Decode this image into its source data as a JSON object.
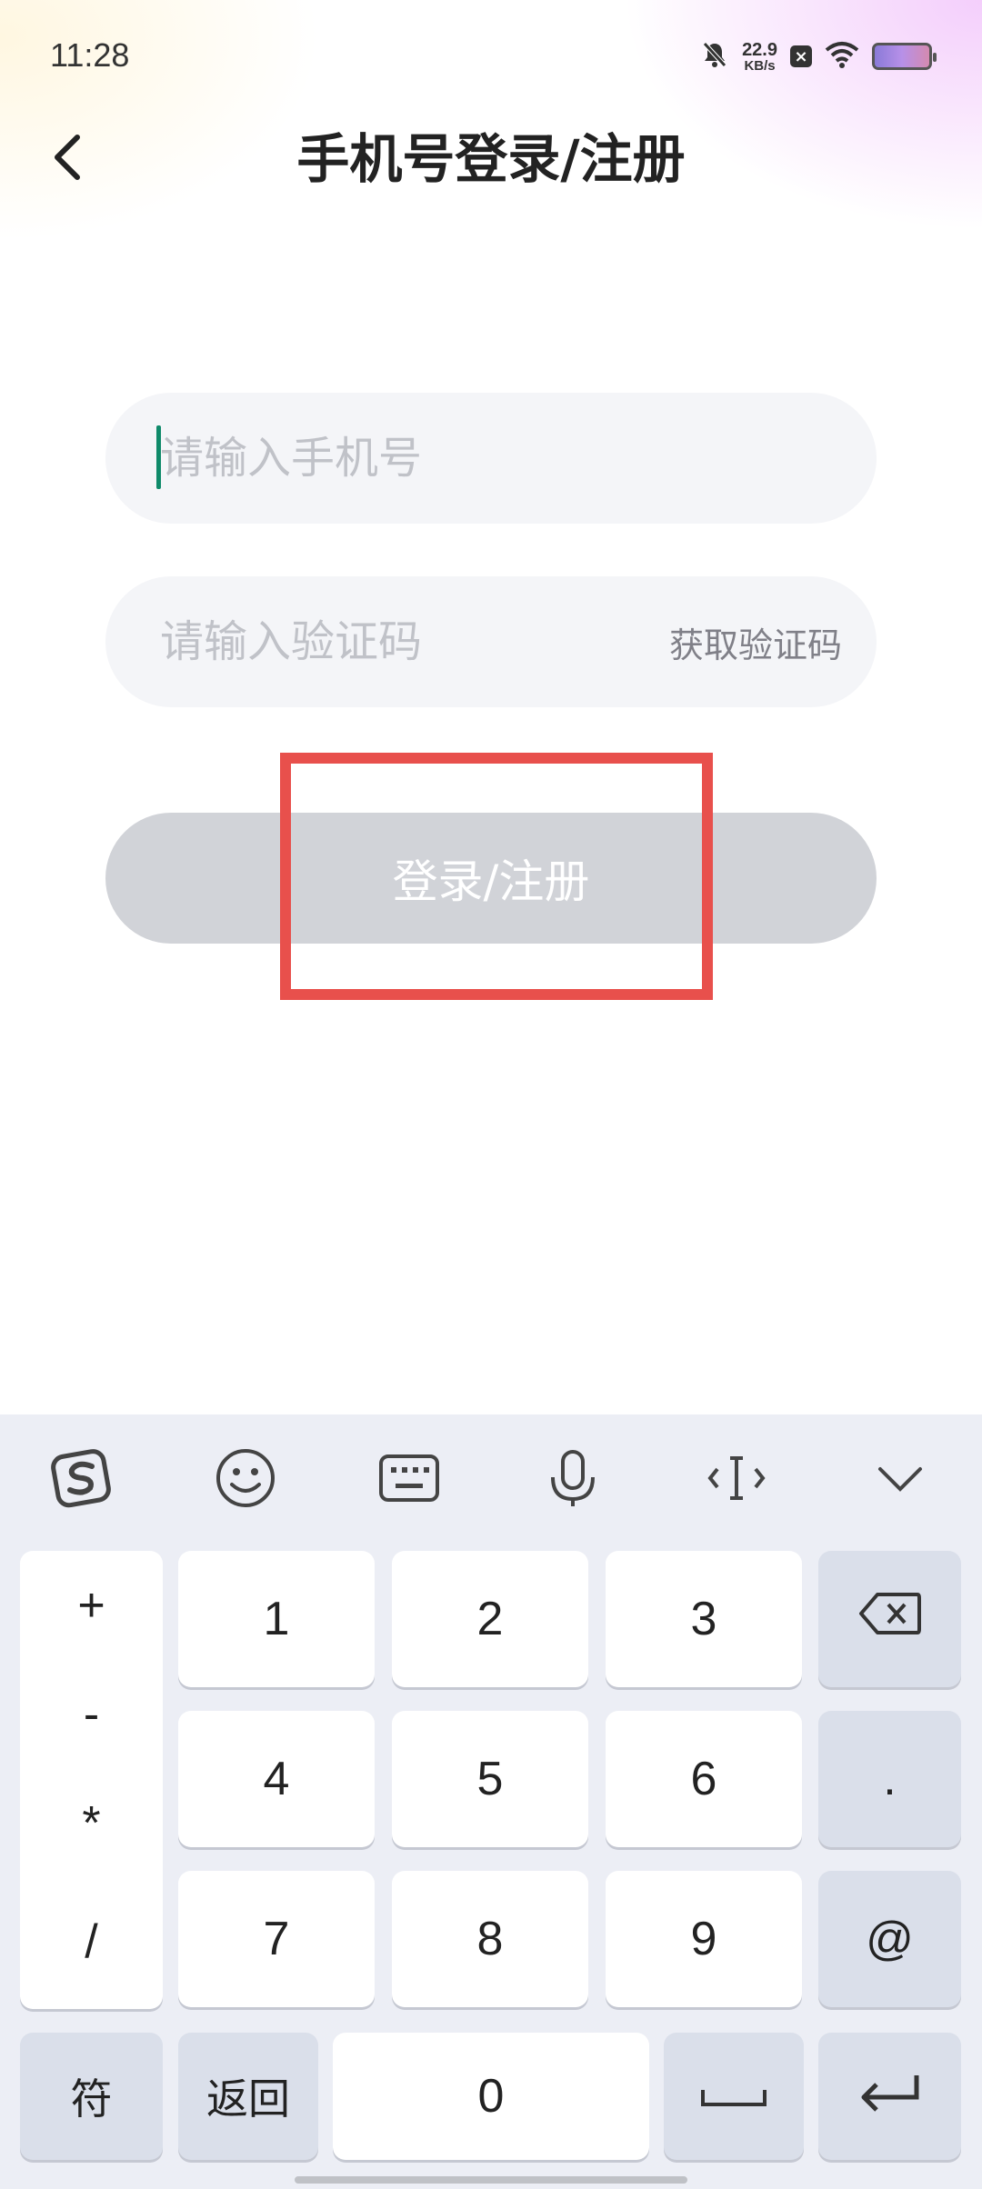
{
  "status_bar": {
    "time": "11:28",
    "net_speed_value": "22.9",
    "net_speed_unit": "KB/s",
    "icons": [
      "bell-off-icon",
      "close-badge-icon",
      "wifi-icon",
      "battery-icon"
    ]
  },
  "header": {
    "title": "手机号登录/注册",
    "back_icon": "chevron-left-icon"
  },
  "form": {
    "phone_placeholder": "请输入手机号",
    "phone_value": "",
    "code_placeholder": "请输入验证码",
    "code_value": "",
    "get_code_label": "获取验证码",
    "submit_label": "登录/注册"
  },
  "keyboard": {
    "toolbar": [
      "sogou-logo-icon",
      "emoji-icon",
      "keyboard-icon",
      "microphone-icon",
      "cursor-move-icon",
      "collapse-chevron-icon"
    ],
    "symbols": [
      "+",
      "-",
      "*",
      "/"
    ],
    "digits": [
      "1",
      "2",
      "3",
      "4",
      "5",
      "6",
      "7",
      "8",
      "9",
      "0"
    ],
    "period": ".",
    "at": "@",
    "sym_label": "符",
    "back_label": "返回"
  },
  "colors": {
    "highlight": "#e8504c",
    "cursor": "#0f8a6a",
    "button_disabled": "#d1d3d8"
  }
}
